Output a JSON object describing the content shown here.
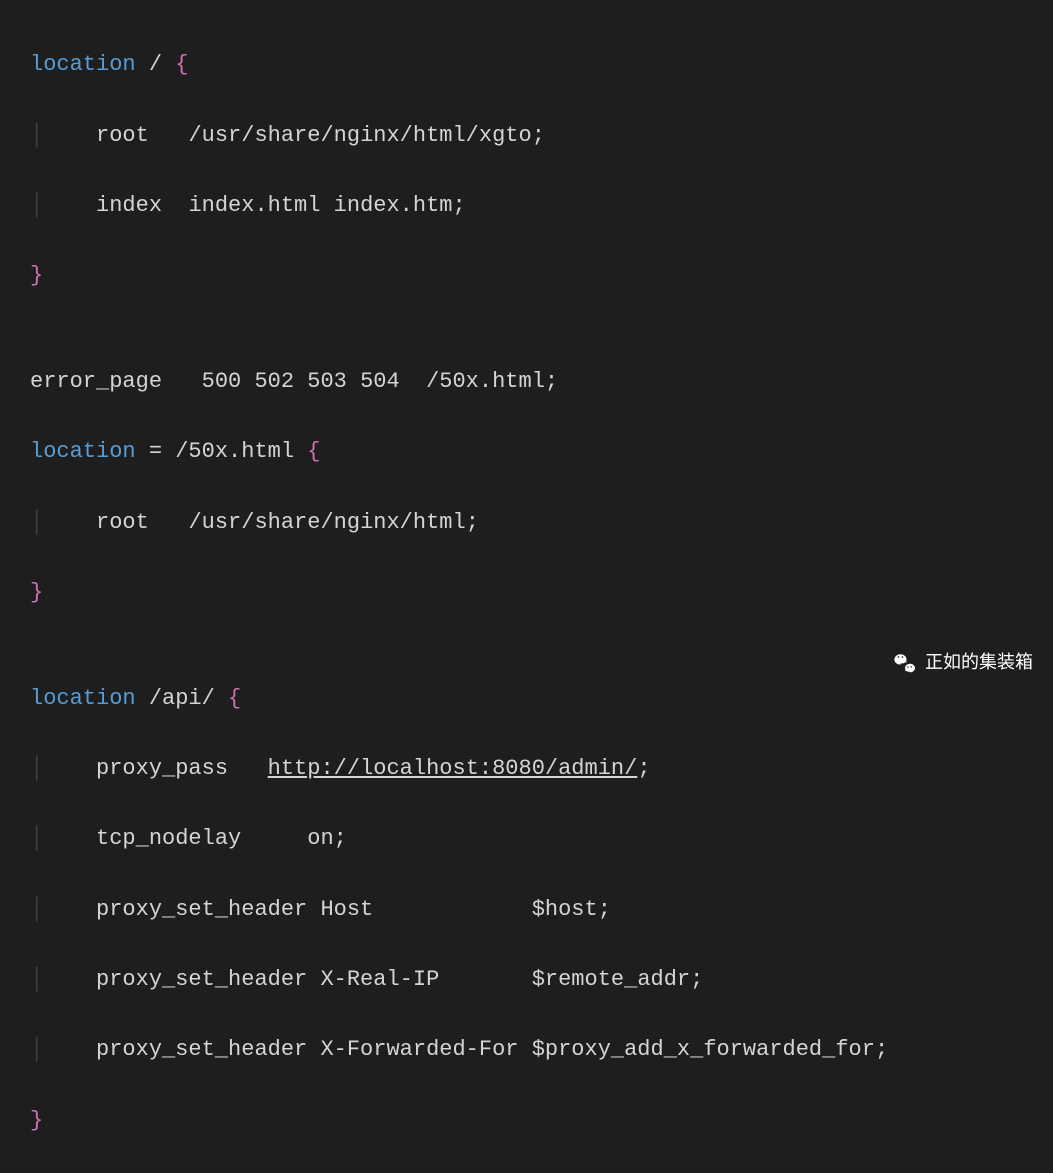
{
  "code": {
    "line1": {
      "keyword": "location",
      "path": " / ",
      "brace": "{"
    },
    "line2": {
      "indent": "    ",
      "directive": "root",
      "spacing": "   ",
      "value": "/usr/share/nginx/html/xgto",
      "semi": ";"
    },
    "line3": {
      "indent": "    ",
      "directive": "index",
      "spacing": "  ",
      "value": "index.html index.htm",
      "semi": ";"
    },
    "line4": {
      "brace": "}"
    },
    "line6": {
      "directive": "error_page",
      "spacing": "   ",
      "value": "500 502 503 504  /50x.html",
      "semi": ";"
    },
    "line7": {
      "keyword": "location",
      "equals": " = ",
      "path": "/50x.html ",
      "brace": "{"
    },
    "line8": {
      "indent": "    ",
      "directive": "root",
      "spacing": "   ",
      "value": "/usr/share/nginx/html",
      "semi": ";"
    },
    "line9": {
      "brace": "}"
    },
    "line11": {
      "keyword": "location",
      "path": " /api/ ",
      "brace": "{"
    },
    "line12": {
      "indent": "    ",
      "directive": "proxy_pass",
      "spacing": "   ",
      "value": "http://localhost:8080/admin/",
      "semi": ";"
    },
    "line13": {
      "indent": "    ",
      "directive": "tcp_nodelay",
      "spacing": "     ",
      "value": "on",
      "semi": ";"
    },
    "line14": {
      "indent": "    ",
      "directive": "proxy_set_header Host",
      "spacing": "            ",
      "value": "$host",
      "semi": ";"
    },
    "line15": {
      "indent": "    ",
      "directive": "proxy_set_header X-Real-IP",
      "spacing": "       ",
      "value": "$remote_addr",
      "semi": ";"
    },
    "line16": {
      "indent": "    ",
      "directive": "proxy_set_header X-Forwarded-For ",
      "value": "$proxy_add_x_forwarded_for",
      "semi": ";"
    },
    "line17": {
      "brace": "}"
    }
  },
  "watermark": {
    "text": "正如的集装箱"
  }
}
